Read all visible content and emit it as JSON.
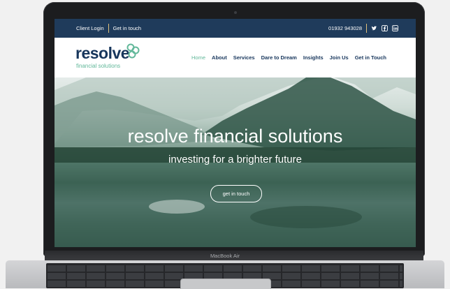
{
  "topbar": {
    "client_login": "Client Login",
    "get_in_touch": "Get in touch",
    "phone": "01932 943028",
    "social_icons": [
      "twitter-icon",
      "facebook-icon",
      "linkedin-icon"
    ]
  },
  "header": {
    "logo_word": "resolve",
    "logo_tagline": "financial solutions"
  },
  "nav": {
    "items": [
      "Home",
      "About",
      "Services",
      "Dare to Dream",
      "Insights",
      "Join Us",
      "Get in Touch"
    ],
    "active": "Home"
  },
  "hero": {
    "title": "resolve financial solutions",
    "subtitle": "investing for a brighter future",
    "button": "get in touch"
  },
  "device": {
    "label": "MacBook Air"
  },
  "colors": {
    "topbar_bg": "#1f3b5b",
    "brand_navy": "#17365c",
    "brand_green": "#62b89a"
  }
}
